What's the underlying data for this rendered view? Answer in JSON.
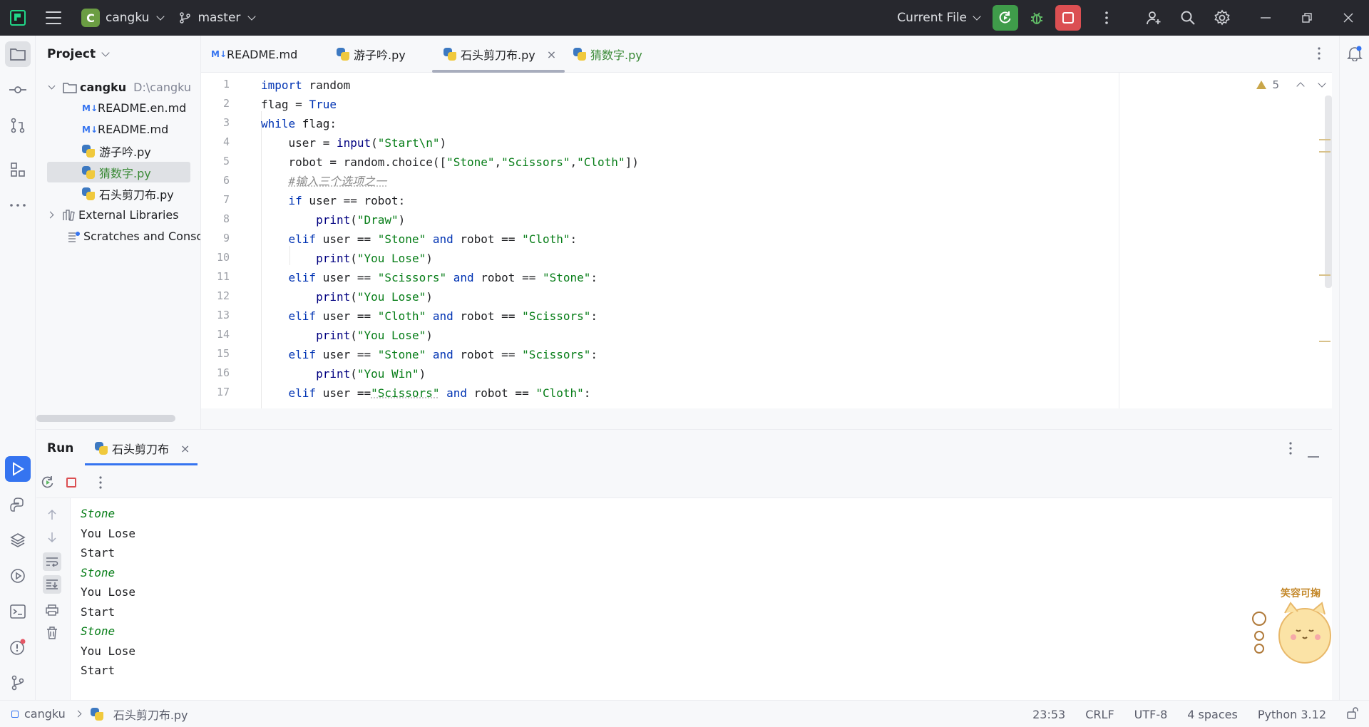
{
  "titlebar": {
    "project_initial": "C",
    "project_name": "cangku",
    "branch": "master",
    "run_config": "Current File"
  },
  "project_panel": {
    "title": "Project",
    "root": {
      "name": "cangku",
      "path": "D:\\cangku"
    },
    "files": [
      {
        "name": "README.en.md",
        "type": "md"
      },
      {
        "name": "README.md",
        "type": "md"
      },
      {
        "name": "游子吟.py",
        "type": "py"
      },
      {
        "name": "猜数字.py",
        "type": "py",
        "selected": true
      },
      {
        "name": "石头剪刀布.py",
        "type": "py"
      }
    ],
    "external_libraries": "External Libraries",
    "scratches": "Scratches and Consoles",
    "md_badge": "M↓"
  },
  "tabs": [
    {
      "label": "README.md",
      "type": "md"
    },
    {
      "label": "游子吟.py",
      "type": "py"
    },
    {
      "label": "石头剪刀布.py",
      "type": "py",
      "active": true
    },
    {
      "label": "猜数字.py",
      "type": "py",
      "modified": true
    }
  ],
  "tab_close": "×",
  "editor": {
    "warnings": "5",
    "line_numbers": [
      "1",
      "2",
      "3",
      "4",
      "5",
      "6",
      "7",
      "8",
      "9",
      "10",
      "11",
      "12",
      "13",
      "14",
      "15",
      "16",
      "17"
    ]
  },
  "run_panel": {
    "title": "Run",
    "tab_label": "石头剪刀布",
    "output": [
      {
        "text": "Stone",
        "input": true
      },
      {
        "text": "You Lose",
        "input": false
      },
      {
        "text": "Start",
        "input": false
      },
      {
        "text": "Stone",
        "input": true
      },
      {
        "text": "You Lose",
        "input": false
      },
      {
        "text": "Start",
        "input": false
      },
      {
        "text": "Stone",
        "input": true
      },
      {
        "text": "You Lose",
        "input": false
      },
      {
        "text": "Start",
        "input": false
      }
    ]
  },
  "mascot_text": "笑容可掬",
  "statusbar": {
    "project": "cangku",
    "file": "石头剪刀布.py",
    "position": "23:53",
    "line_ending": "CRLF",
    "encoding": "UTF-8",
    "indent": "4 spaces",
    "interpreter": "Python 3.12"
  }
}
